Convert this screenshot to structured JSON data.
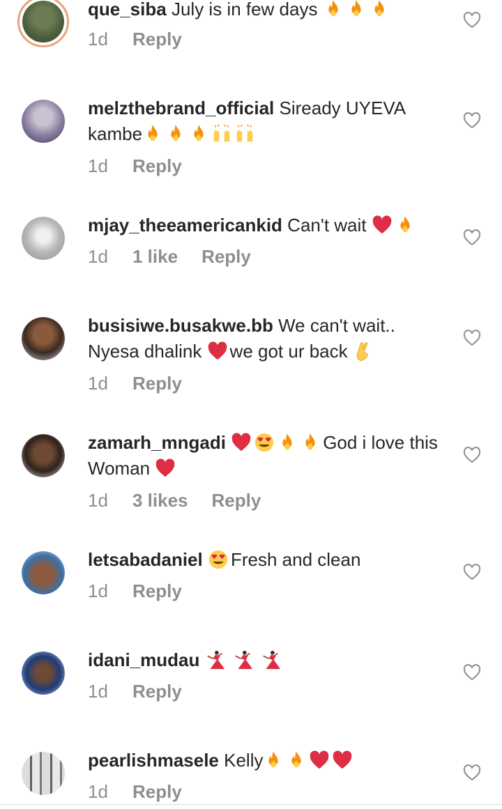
{
  "comments": [
    {
      "username": "que_siba",
      "text": "July is in few days",
      "emoji_after": [
        "fire",
        "fire",
        "fire"
      ],
      "time": "1d",
      "likes": "",
      "reply": "Reply"
    },
    {
      "username": "melzthebrand_official",
      "text": "Siready UYEVA kambe",
      "emoji_after": [
        "fire",
        "fire",
        "fire",
        "raised-hands",
        "raised-hands"
      ],
      "time": "1d",
      "likes": "",
      "reply": "Reply"
    },
    {
      "username": "mjay_theeamericankid",
      "text": "Can't wait",
      "emoji_after": [
        "red-heart",
        "fire"
      ],
      "time": "1d",
      "likes": "1 like",
      "reply": "Reply"
    },
    {
      "username": "busisiwe.busakwe.bb",
      "text_a": "We can't wait.. Nyesa dhalink",
      "emoji_mid": [
        "red-heart"
      ],
      "text_b": "we got ur back",
      "emoji_after": [
        "crossed-fingers"
      ],
      "time": "1d",
      "likes": "",
      "reply": "Reply"
    },
    {
      "username": "zamarh_mngadi",
      "emoji_before": [
        "red-heart",
        "heart-eyes",
        "fire",
        "fire"
      ],
      "text": "God i love this Woman",
      "emoji_after": [
        "red-heart"
      ],
      "time": "1d",
      "likes": "3 likes",
      "reply": "Reply"
    },
    {
      "username": "letsabadaniel",
      "emoji_before": [
        "heart-eyes"
      ],
      "text": "Fresh and clean",
      "time": "1d",
      "likes": "",
      "reply": "Reply"
    },
    {
      "username": "idani_mudau",
      "emoji_after": [
        "dancer",
        "dancer",
        "dancer"
      ],
      "time": "1d",
      "likes": "",
      "reply": "Reply"
    },
    {
      "username": "pearlishmasele",
      "text": "Kelly",
      "emoji_after": [
        "fire",
        "fire",
        "red-heart",
        "red-heart"
      ],
      "time": "1d",
      "likes": "",
      "reply": "Reply"
    }
  ],
  "colors": {
    "text": "#262626",
    "meta": "#8e8e8e",
    "fire": "#f4900c",
    "heart": "#dd2e44",
    "story_ring": "#e8a37a"
  }
}
